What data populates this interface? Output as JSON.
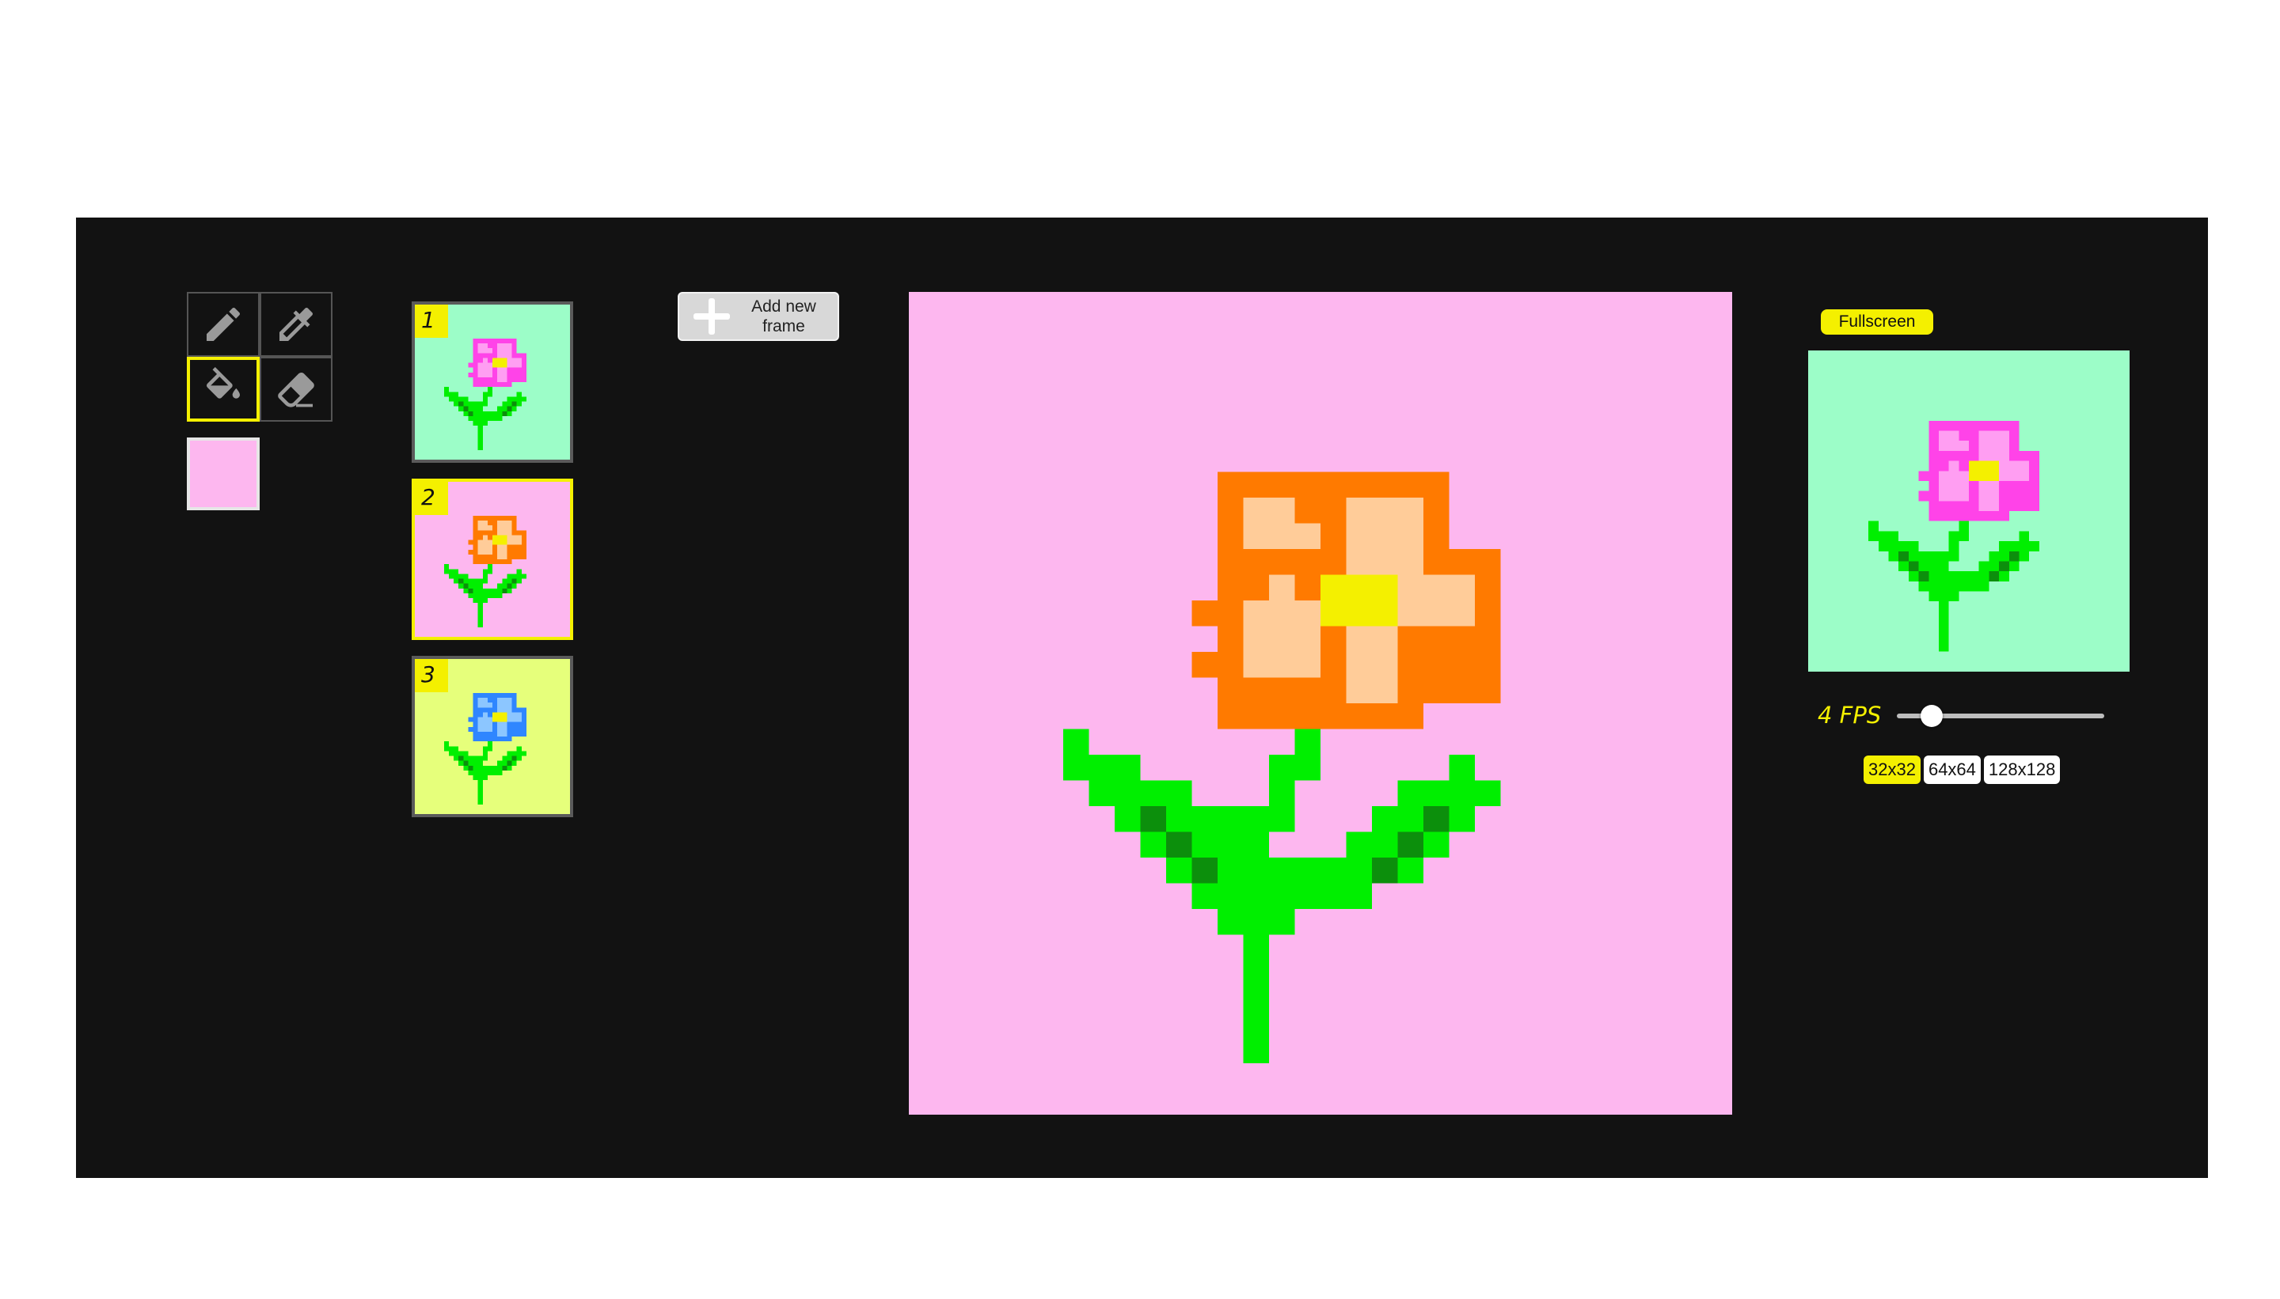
{
  "tools": [
    {
      "name": "pencil",
      "icon": "pencil-icon",
      "active": false
    },
    {
      "name": "eyedropper",
      "icon": "eyedropper-icon",
      "active": false
    },
    {
      "name": "fill",
      "icon": "paint-bucket-icon",
      "active": true
    },
    {
      "name": "eraser",
      "icon": "eraser-icon",
      "active": false
    }
  ],
  "current_color": "#fdb7ef",
  "palette": {
    "green_bg": "#9cfdc8",
    "pink_bg": "#fdb7ef",
    "yellow_bg": "#e6ff7b",
    "stem": "#00ef00",
    "leaf_dark": "#0c8f0c",
    "accent": "#f4f000"
  },
  "frames": [
    {
      "number": "1",
      "background": "#9cfdc8",
      "petal_outer": "#ff43e8",
      "petal_inner": "#ff9ef2",
      "center": "#f4f000",
      "active": false
    },
    {
      "number": "2",
      "background": "#fdb7ef",
      "petal_outer": "#ff7a00",
      "petal_inner": "#ffcc99",
      "center": "#f4f000",
      "active": true
    },
    {
      "number": "3",
      "background": "#e6ff7b",
      "petal_outer": "#2f86ff",
      "petal_inner": "#8cc6ff",
      "center": "#f4f000",
      "active": false
    }
  ],
  "add_frame": {
    "label": "Add new\nframe"
  },
  "preview": {
    "fullscreen_label": "Fullscreen",
    "fps_label": "4 FPS",
    "fps_value": 4,
    "fps_fraction": 0.13,
    "sizes": [
      {
        "label": "32x32",
        "active": true
      },
      {
        "label": "64x64",
        "active": false
      },
      {
        "label": "128x128",
        "active": false
      }
    ],
    "frame_index": 0
  },
  "canvas": {
    "frame_index": 1
  }
}
